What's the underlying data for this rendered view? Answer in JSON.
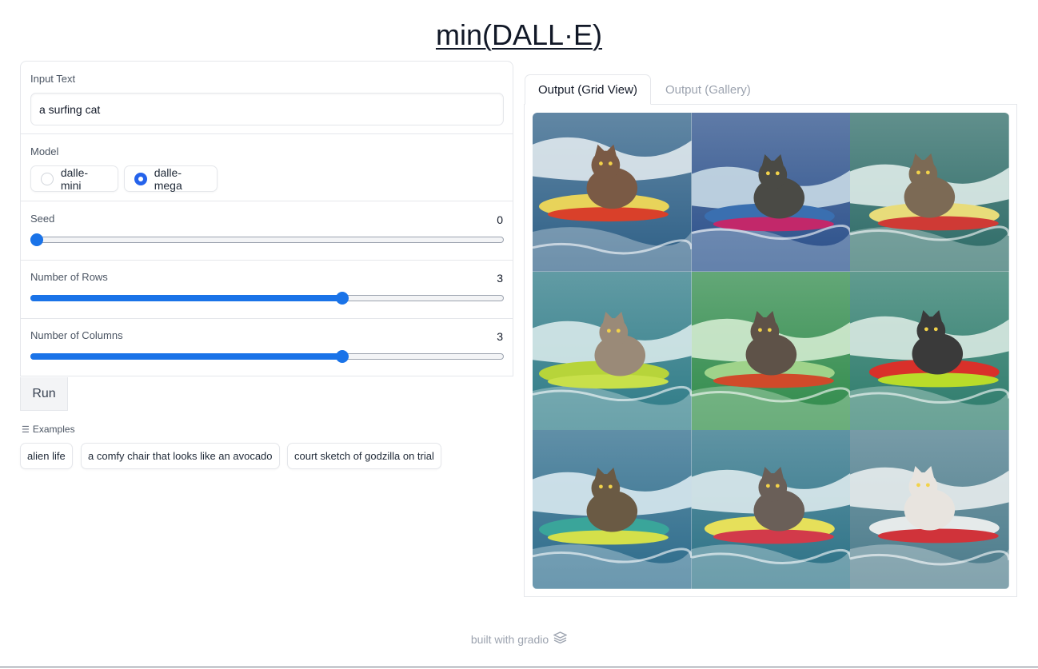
{
  "title": "min(DALL·E)",
  "input": {
    "label": "Input Text",
    "value": "a surfing cat"
  },
  "model": {
    "label": "Model",
    "options": [
      "dalle-mini",
      "dalle-mega"
    ],
    "selected": "dalle-mega"
  },
  "seed": {
    "label": "Seed",
    "value": "0",
    "fraction": 0.0
  },
  "rows": {
    "label": "Number of Rows",
    "value": "3",
    "fraction": 0.663
  },
  "columns": {
    "label": "Number of Columns",
    "value": "3",
    "fraction": 0.663
  },
  "run_label": "Run",
  "examples": {
    "label": "Examples",
    "items": [
      "alien life",
      "a comfy chair that looks like an avocado",
      "court sketch of godzilla on trial"
    ]
  },
  "tabs": [
    "Output (Grid View)",
    "Output (Gallery)"
  ],
  "gallery": {
    "tiles": [
      {
        "sea": "#2d5f86",
        "wave": "#e8eef2",
        "board": "#d9402a",
        "board2": "#e8d35a",
        "cat": "#7a5a45"
      },
      {
        "sea": "#2a4f8a",
        "wave": "#cfe0ea",
        "board": "#c2286a",
        "board2": "#3a6fb0",
        "cat": "#4a4a45"
      },
      {
        "sea": "#2c6a66",
        "wave": "#e6f2ee",
        "board": "#cf3a35",
        "board2": "#e8dc7a",
        "cat": "#7c6a55"
      },
      {
        "sea": "#2d7a86",
        "wave": "#dfeeee",
        "board": "#c8e04a",
        "board2": "#b7d43a",
        "cat": "#9a8a78"
      },
      {
        "sea": "#2f8a4a",
        "wave": "#d9f0d6",
        "board": "#d04a2a",
        "board2": "#9fd38a",
        "cat": "#5e5248"
      },
      {
        "sea": "#2b7a6a",
        "wave": "#e0eee8",
        "board": "#b9dc2a",
        "board2": "#d9302a",
        "cat": "#3a3a3a"
      },
      {
        "sea": "#2b6a8a",
        "wave": "#e1eef4",
        "board": "#d4e04a",
        "board2": "#3aa59a",
        "cat": "#6a5a44"
      },
      {
        "sea": "#2a7085",
        "wave": "#e4f0f2",
        "board": "#d23a4a",
        "board2": "#e6e05a",
        "cat": "#6a5f58"
      },
      {
        "sea": "#4a7a8a",
        "wave": "#eef2f2",
        "board": "#d0333a",
        "board2": "#e5eaea",
        "cat": "#e8e4df"
      }
    ]
  },
  "footer": "built with gradio"
}
